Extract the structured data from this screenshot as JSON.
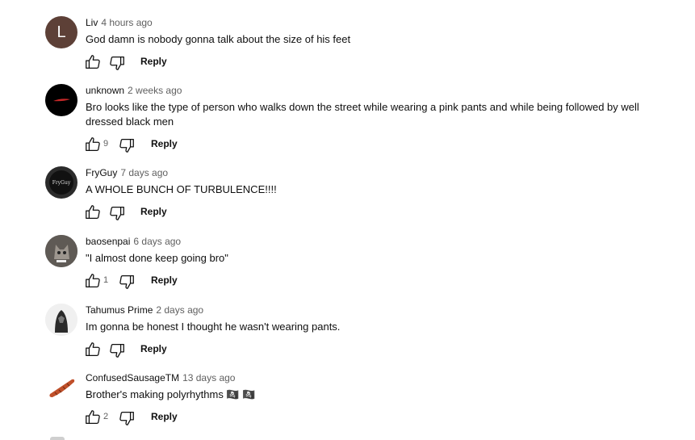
{
  "comments": [
    {
      "author": "Liv",
      "time": "4 hours ago",
      "text": "God damn is nobody gonna talk about the size of his feet",
      "likes": "",
      "reply": "Reply",
      "avatar_letter": "L",
      "avatar_color": "#5d4037"
    },
    {
      "author": "unknown",
      "time": "2 weeks ago",
      "text": "Bro looks like the type of person who walks down the street while wearing a pink pants and while being followed by well dressed black men",
      "likes": "9",
      "reply": "Reply"
    },
    {
      "author": "FryGuy",
      "time": "7 days ago",
      "text": "A WHOLE BUNCH OF TURBULENCE!!!!",
      "likes": "",
      "reply": "Reply",
      "avatar_label": "FryGuy"
    },
    {
      "author": "baosenpai",
      "time": "6 days ago",
      "text": "\"I almost done keep going bro\"",
      "likes": "1",
      "reply": "Reply"
    },
    {
      "author": "Tahumus Prime",
      "time": "2 days ago",
      "text": "Im gonna be honest I thought he wasn't wearing pants.",
      "likes": "",
      "reply": "Reply"
    },
    {
      "author": "ConfusedSausageTM",
      "time": "13 days ago",
      "text": "Brother's making polyrhythms 🏴‍☠️ 🏴‍☠️",
      "likes": "2",
      "reply": "Reply"
    }
  ]
}
